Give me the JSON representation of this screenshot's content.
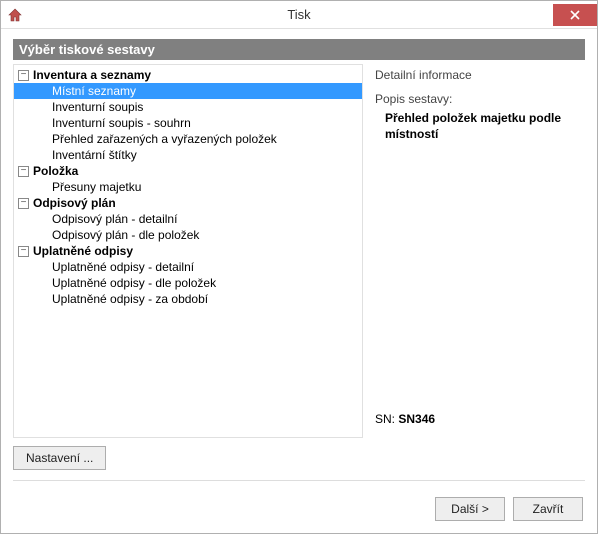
{
  "window": {
    "title": "Tisk"
  },
  "section_header": "Výběr tiskové sestavy",
  "tree": {
    "groups": [
      {
        "label": "Inventura a seznamy",
        "items": [
          {
            "label": "Místní seznamy",
            "selected": true
          },
          {
            "label": "Inventurní soupis"
          },
          {
            "label": "Inventurní soupis - souhrn"
          },
          {
            "label": "Přehled zařazených a vyřazených položek"
          },
          {
            "label": "Inventární štítky"
          }
        ]
      },
      {
        "label": "Položka",
        "items": [
          {
            "label": "Přesuny majetku"
          }
        ]
      },
      {
        "label": "Odpisový plán",
        "items": [
          {
            "label": "Odpisový plán - detailní"
          },
          {
            "label": "Odpisový plán - dle položek"
          }
        ]
      },
      {
        "label": "Uplatněné odpisy",
        "items": [
          {
            "label": "Uplatněné odpisy - detailní"
          },
          {
            "label": "Uplatněné odpisy - dle položek"
          },
          {
            "label": "Uplatněné odpisy - za období"
          }
        ]
      }
    ]
  },
  "detail": {
    "title": "Detailní informace",
    "desc_label": "Popis sestavy:",
    "desc_text": "Přehled položek majetku podle místností",
    "sn_label": "SN:",
    "sn_value": "SN346"
  },
  "buttons": {
    "settings": "Nastavení ...",
    "next": "Další >",
    "close": "Zavřít"
  },
  "expander_glyph": "⊟"
}
